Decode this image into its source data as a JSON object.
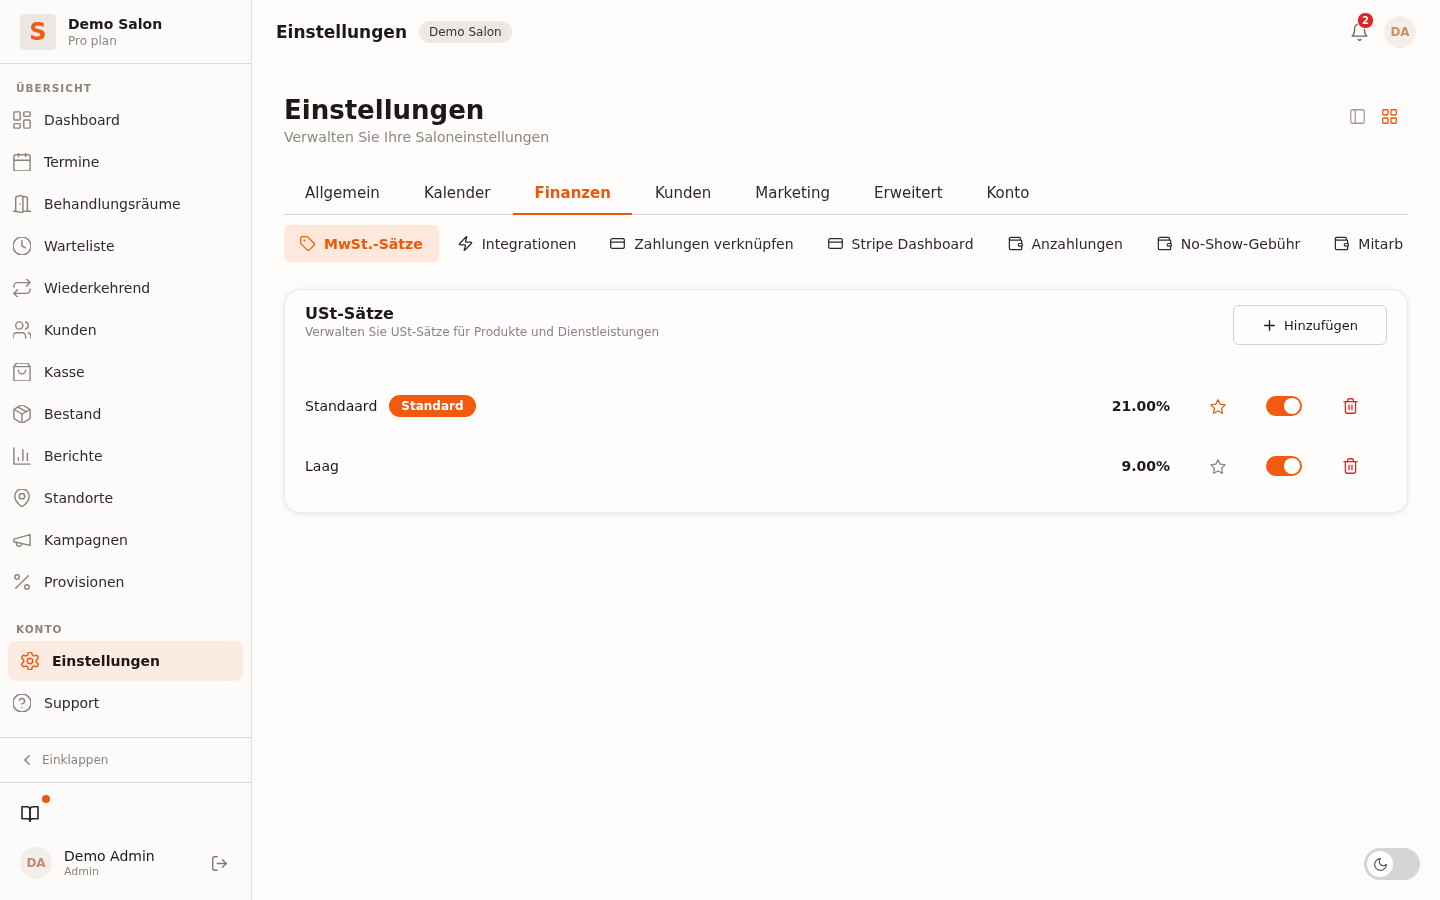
{
  "sidebar": {
    "brand": {
      "logo": "S",
      "name": "Demo Salon",
      "plan": "Pro plan"
    },
    "sections": [
      {
        "title": "ÜBERSICHT",
        "items": [
          {
            "label": "Dashboard",
            "selected": false
          },
          {
            "label": "Termine",
            "selected": false
          },
          {
            "label": "Behandlungsräume",
            "selected": false
          },
          {
            "label": "Warteliste",
            "selected": false
          },
          {
            "label": "Wiederkehrend",
            "selected": false
          },
          {
            "label": "Kunden",
            "selected": false
          },
          {
            "label": "Kasse",
            "selected": false
          },
          {
            "label": "Bestand",
            "selected": false
          },
          {
            "label": "Berichte",
            "selected": false
          },
          {
            "label": "Standorte",
            "selected": false
          },
          {
            "label": "Kampagnen",
            "selected": false
          },
          {
            "label": "Provisionen",
            "selected": false
          }
        ]
      },
      {
        "title": "KONTO",
        "items": [
          {
            "label": "Einstellungen",
            "selected": true
          },
          {
            "label": "Support",
            "selected": false
          }
        ]
      }
    ],
    "collapse": "Einklappen",
    "guide": {
      "unread": true
    },
    "user": {
      "initials": "DA",
      "name": "Demo Admin",
      "role": "Admin"
    }
  },
  "header": {
    "title": "Einstellungen",
    "badge": "Demo Salon",
    "notifications": "2",
    "avatar": "DA"
  },
  "page": {
    "title": "Einstellungen",
    "subtitle": "Verwalten Sie Ihre Saloneinstellungen",
    "view_toggle": [
      {
        "kind": "panel",
        "selected": false
      },
      {
        "kind": "grid",
        "selected": true
      }
    ]
  },
  "tabs": [
    {
      "label": "Allgemein",
      "selected": false
    },
    {
      "label": "Kalender",
      "selected": false
    },
    {
      "label": "Finanzen",
      "selected": true
    },
    {
      "label": "Kunden",
      "selected": false
    },
    {
      "label": "Marketing",
      "selected": false
    },
    {
      "label": "Erweitert",
      "selected": false
    },
    {
      "label": "Konto",
      "selected": false
    }
  ],
  "subtabs": [
    {
      "label": "MwSt.-Sätze",
      "selected": true
    },
    {
      "label": "Integrationen",
      "selected": false
    },
    {
      "label": "Zahlungen verknüpfen",
      "selected": false
    },
    {
      "label": "Stripe Dashboard",
      "selected": false
    },
    {
      "label": "Anzahlungen",
      "selected": false
    },
    {
      "label": "No-Show-Gebühr",
      "selected": false
    },
    {
      "label": "Mitarb",
      "selected": false
    }
  ],
  "card": {
    "title": "USt-Sätze",
    "subtitle": "Verwalten Sie USt-Sätze für Produkte und Dienstleistungen",
    "add_button": "Hinzufügen",
    "rows": [
      {
        "name": "Standaard",
        "badge": "Standard",
        "rate": "21.00%",
        "default": true,
        "on": true
      },
      {
        "name": "Laag",
        "rate": "9.00%",
        "default": false,
        "on": true
      }
    ]
  },
  "theme_toggle": {
    "dark": false
  }
}
